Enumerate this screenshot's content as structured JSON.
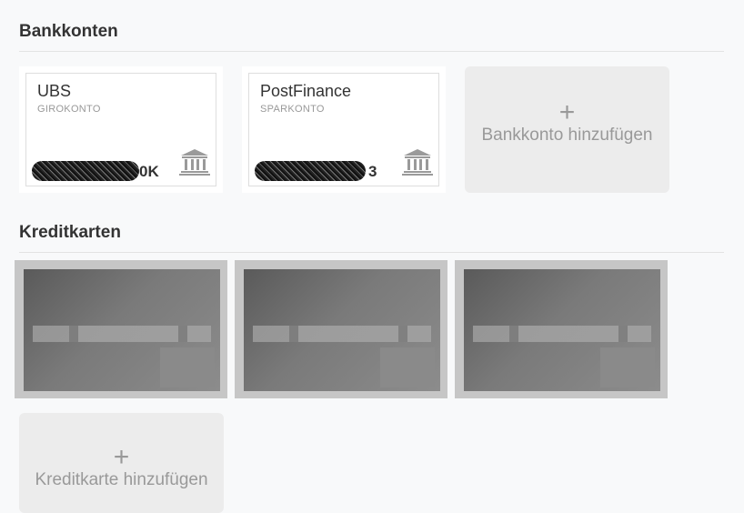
{
  "bank_accounts": {
    "title": "Bankkonten",
    "items": [
      {
        "name": "UBS",
        "type": "GIROKONTO",
        "iban_tail": "0K"
      },
      {
        "name": "PostFinance",
        "type": "SPARKONTO",
        "iban_tail": "3"
      }
    ],
    "add_plus": "+",
    "add_label": "Bankkonto hinzufügen"
  },
  "credit_cards": {
    "title": "Kreditkarten",
    "add_plus": "+",
    "add_label": "Kreditkarte hinzufügen"
  }
}
